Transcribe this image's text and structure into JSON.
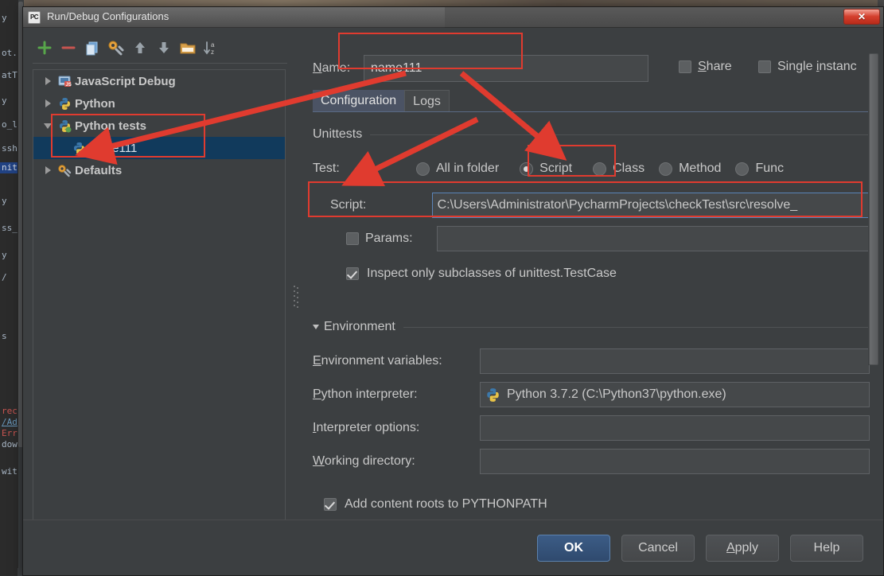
{
  "window": {
    "title": "Run/Debug Configurations",
    "app_icon": "pycharm-icon",
    "close_label": "✕"
  },
  "toolbar": {
    "items": [
      {
        "name": "add-configuration-button",
        "icon": "plus-icon",
        "glyph": "+"
      },
      {
        "name": "remove-configuration-button",
        "icon": "minus-icon",
        "glyph": "−"
      },
      {
        "name": "copy-configuration-button",
        "icon": "copy-icon",
        "glyph": "❐"
      },
      {
        "name": "edit-templates-button",
        "icon": "wrench-icon",
        "glyph": "🔧"
      },
      {
        "name": "move-up-button",
        "icon": "arrow-up-icon",
        "glyph": "↑"
      },
      {
        "name": "move-down-button",
        "icon": "arrow-down-icon",
        "glyph": "↓"
      },
      {
        "name": "move-into-folder-button",
        "icon": "folder-icon",
        "glyph": "📁"
      },
      {
        "name": "sort-configurations-button",
        "icon": "sort-az-icon",
        "glyph": "↓az"
      }
    ]
  },
  "tree": {
    "items": [
      {
        "label": "JavaScript Debug",
        "expanded": false,
        "selected": false,
        "depth": 0,
        "icon": "javascript-debug-icon"
      },
      {
        "label": "Python",
        "expanded": false,
        "selected": false,
        "depth": 0,
        "icon": "python-icon"
      },
      {
        "label": "Python tests",
        "expanded": true,
        "selected": false,
        "depth": 0,
        "icon": "python-tests-icon"
      },
      {
        "label": "name111",
        "expanded": null,
        "selected": true,
        "depth": 1,
        "icon": "python-test-config-icon"
      },
      {
        "label": "Defaults",
        "expanded": false,
        "selected": false,
        "depth": 0,
        "icon": "defaults-gear-icon"
      }
    ]
  },
  "header": {
    "name_label": "Name:",
    "name_mnemonic": "N",
    "name_value": "name111",
    "share_label": "Share",
    "share_mnemonic": "S",
    "share_checked": false,
    "single_instance_label": "Single instanc",
    "single_instance_mnemonic": "i",
    "single_instance_checked": false
  },
  "tabs": [
    {
      "label": "Configuration",
      "active": true
    },
    {
      "label": "Logs",
      "active": false
    }
  ],
  "unittests": {
    "section_title": "Unittests",
    "test_label": "Test:",
    "options": [
      {
        "label": "All in folder",
        "selected": false
      },
      {
        "label": "Script",
        "selected": true
      },
      {
        "label": "Class",
        "selected": false
      },
      {
        "label": "Method",
        "selected": false
      },
      {
        "label": "Func",
        "selected": false
      }
    ],
    "script_label": "Script:",
    "script_value": "C:\\Users\\Administrator\\PycharmProjects\\checkTest\\src\\resolve_",
    "params_label": "Params:",
    "params_checked": false,
    "params_value": "",
    "inspect_label": "Inspect only subclasses of unittest.TestCase",
    "inspect_checked": true
  },
  "environment": {
    "section_title": "Environment",
    "expanded": true,
    "env_vars_label": "Environment variables:",
    "env_vars_mnemonic": "E",
    "env_vars_value": "",
    "interpreter_label": "Python interpreter:",
    "interpreter_mnemonic": "P",
    "interpreter_value": "Python 3.7.2 (C:\\Python37\\python.exe)",
    "interpreter_icon": "python-icon",
    "interpreter_options_label": "Interpreter options:",
    "interpreter_options_mnemonic": "I",
    "interpreter_options_value": "",
    "working_dir_label": "Working directory:",
    "working_dir_mnemonic": "W",
    "working_dir_value": "",
    "pythonpath_label": "Add content roots to PYTHONPATH",
    "pythonpath_checked": true
  },
  "buttons": [
    {
      "label": "OK",
      "default": true,
      "mnemonic": ""
    },
    {
      "label": "Cancel",
      "default": false,
      "mnemonic": ""
    },
    {
      "label": "Apply",
      "default": false,
      "mnemonic": "A"
    },
    {
      "label": "Help",
      "default": false,
      "mnemonic": ""
    }
  ],
  "annotations": {
    "color": "#e03b2f",
    "boxes": [
      "name-field-highlight",
      "tree-python-tests-highlight",
      "script-radio-highlight",
      "script-row-highlight"
    ],
    "arrows": [
      "arrow-name-to-tree",
      "arrow-name-to-script-radio",
      "arrow-to-script-label"
    ]
  },
  "background_ide": {
    "lines": [
      "y",
      "ot.",
      "atT",
      "y",
      "o_l",
      "ssh",
      "nit",
      "y",
      "ss_",
      "y",
      "/",
      "s",
      "rece",
      "/Adn",
      "Erro",
      "dows",
      "wit"
    ]
  }
}
